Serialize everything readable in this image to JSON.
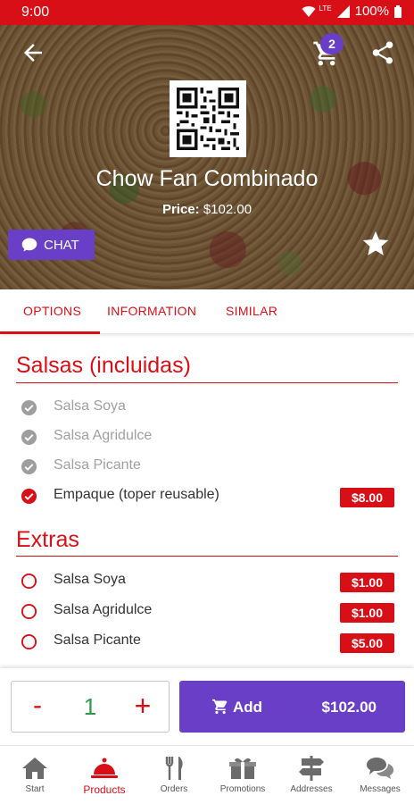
{
  "status_bar": {
    "time": "9:00",
    "network": "LTE",
    "battery": "100%"
  },
  "header": {
    "back_icon": "arrow-left-icon",
    "cart_icon": "cart-icon",
    "cart_count": "2",
    "share_icon": "share-icon"
  },
  "product": {
    "name": "Chow Fan Combinado",
    "price_label": "Price:",
    "price_value": "$102.00",
    "chat_label": "CHAT",
    "favorite_icon": "star-icon"
  },
  "tabs": [
    {
      "label": "OPTIONS",
      "active": true
    },
    {
      "label": "INFORMATION",
      "active": false
    },
    {
      "label": "SIMILAR",
      "active": false
    }
  ],
  "sections": [
    {
      "title": "Salsas (incluidas)",
      "items": [
        {
          "label": "Salsa Soya",
          "state": "included-disabled",
          "price": ""
        },
        {
          "label": "Salsa Agridulce",
          "state": "included-disabled",
          "price": ""
        },
        {
          "label": "Salsa Picante",
          "state": "included-disabled",
          "price": ""
        },
        {
          "label": "Empaque (toper reusable)",
          "state": "checked",
          "price": "$8.00"
        }
      ]
    },
    {
      "title": "Extras",
      "items": [
        {
          "label": "Salsa Soya",
          "state": "unchecked",
          "price": "$1.00"
        },
        {
          "label": "Salsa Agridulce",
          "state": "unchecked",
          "price": "$1.00"
        },
        {
          "label": "Salsa Picante",
          "state": "unchecked",
          "price": "$5.00"
        }
      ]
    }
  ],
  "order_bar": {
    "minus": "-",
    "quantity": "1",
    "plus": "+",
    "add_label": "Add",
    "add_total": "$102.00"
  },
  "nav": [
    {
      "label": "Start",
      "icon": "home-icon",
      "active": false
    },
    {
      "label": "Products",
      "icon": "cloche-icon",
      "active": true
    },
    {
      "label": "Orders",
      "icon": "utensils-icon",
      "active": false
    },
    {
      "label": "Promotions",
      "icon": "gift-icon",
      "active": false
    },
    {
      "label": "Addresses",
      "icon": "signpost-icon",
      "active": false
    },
    {
      "label": "Messages",
      "icon": "chat-bubbles-icon",
      "active": false
    }
  ],
  "colors": {
    "primary": "#d90f17",
    "accent": "#6a3fc8",
    "quantity": "#2e9b4b"
  }
}
